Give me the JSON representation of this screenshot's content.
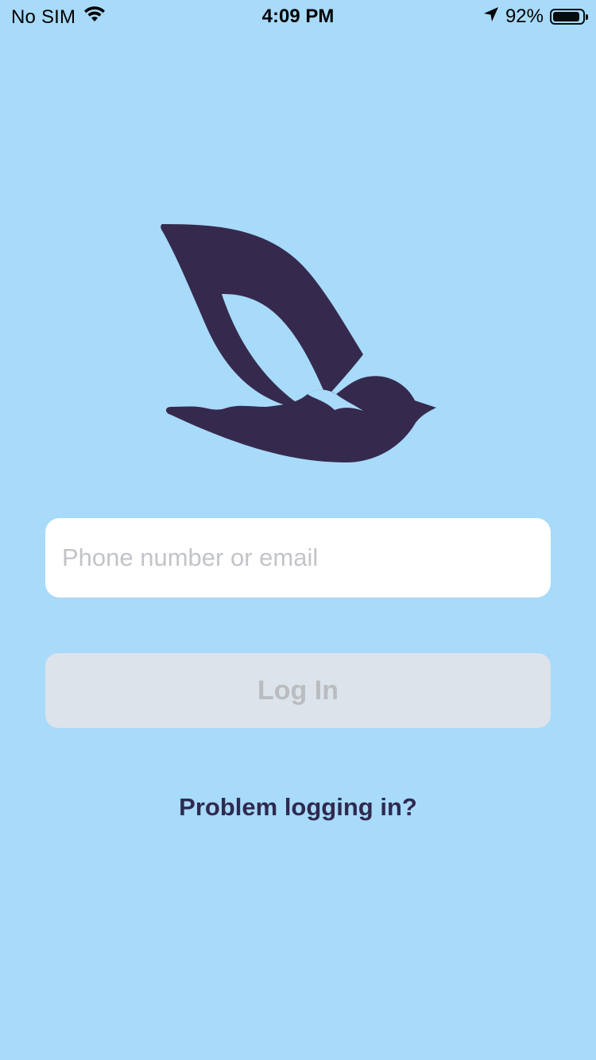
{
  "status_bar": {
    "carrier": "No SIM",
    "time": "4:09 PM",
    "battery_percent": "92%",
    "battery_level": 0.92,
    "icons": [
      "wifi-icon",
      "location-arrow-icon",
      "battery-icon"
    ]
  },
  "logo": {
    "icon": "bird-logo-icon",
    "color": "#352a4d"
  },
  "login_form": {
    "identifier_placeholder": "Phone number or email",
    "identifier_value": "",
    "login_label": "Log In",
    "problem_link": "Problem logging in?"
  },
  "colors": {
    "background": "#a8dafa",
    "brand": "#352a4d",
    "button_disabled_bg": "#dde3ea",
    "button_disabled_text": "#b9bcc0",
    "placeholder": "#c1c4c8"
  }
}
